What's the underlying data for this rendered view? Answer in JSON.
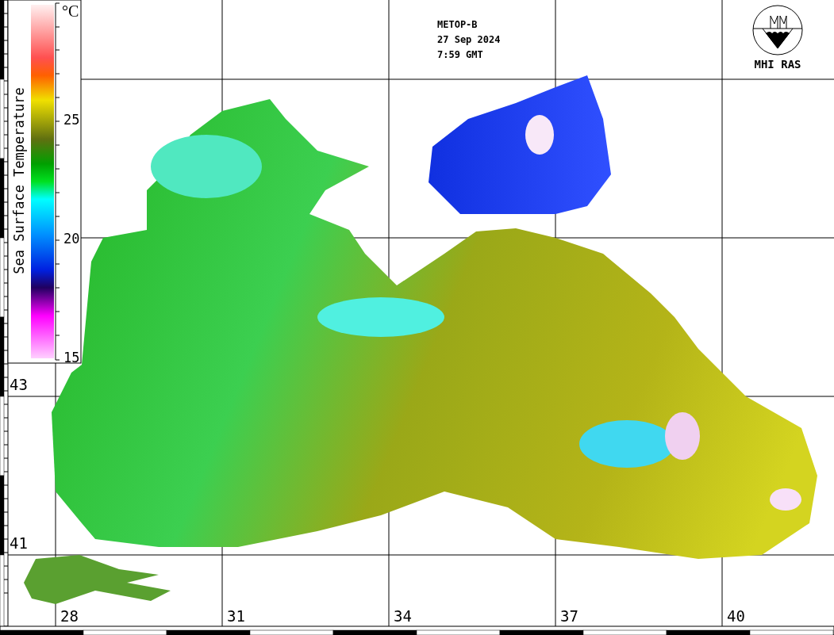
{
  "header": {
    "satellite": "METOP-B",
    "date": "27 Sep 2024",
    "time": "7:59 GMT"
  },
  "logo": {
    "label": "MHI RAS"
  },
  "legend": {
    "title": "Sea Surface Temperature",
    "unit": "°C",
    "ticks": [
      "25",
      "20",
      "15"
    ]
  },
  "map": {
    "longitudes": [
      "28",
      "31",
      "34",
      "37",
      "40"
    ],
    "latitudes": [
      "43",
      "41"
    ]
  }
}
